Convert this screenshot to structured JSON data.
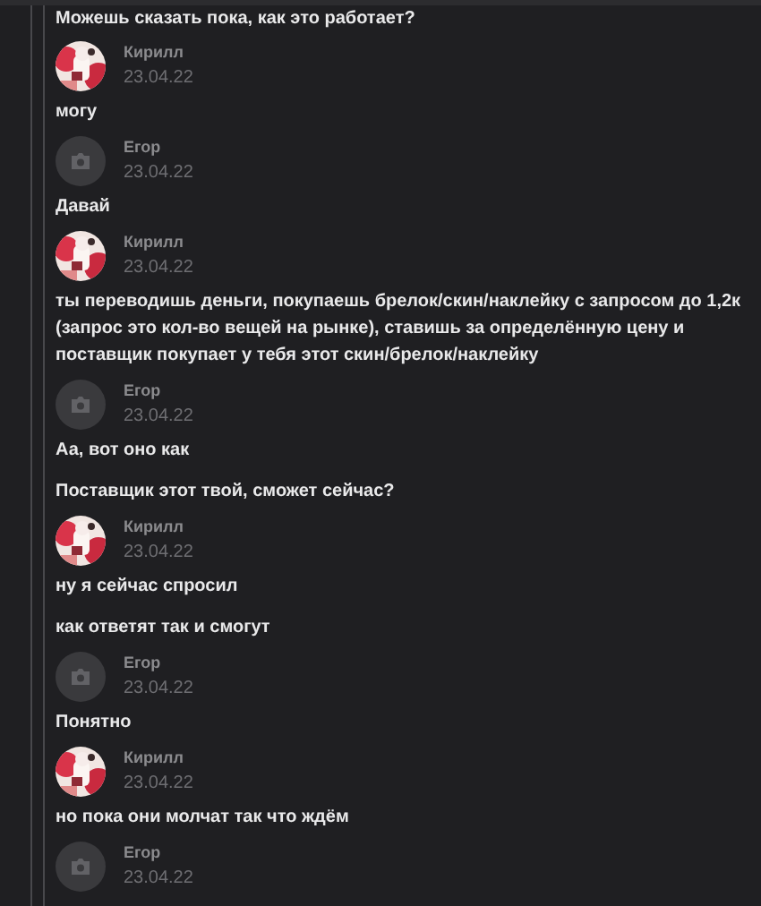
{
  "preceding_text": "Можешь сказать пока, как это работает?",
  "posts": [
    {
      "author": "Кирилл",
      "date": "23.04.22",
      "avatar": {
        "kind": "picture"
      },
      "texts": [
        "могу"
      ]
    },
    {
      "author": "Егор",
      "date": "23.04.22",
      "avatar": {
        "kind": "placeholder"
      },
      "texts": [
        "Давай"
      ]
    },
    {
      "author": "Кирилл",
      "date": "23.04.22",
      "avatar": {
        "kind": "picture"
      },
      "texts": [
        "ты переводишь деньги, покупаешь брелок/скин/наклейку с запросом до 1,2к (запрос это кол-во вещей на рынке), ставишь за определённую цену и поставщик покупает у тебя этот скин/брелок/наклейку"
      ]
    },
    {
      "author": "Егор",
      "date": "23.04.22",
      "avatar": {
        "kind": "placeholder"
      },
      "texts": [
        "Аа, вот оно как",
        "Поставщик этот твой, сможет сейчас?"
      ]
    },
    {
      "author": "Кирилл",
      "date": "23.04.22",
      "avatar": {
        "kind": "picture"
      },
      "texts": [
        "ну я сейчас спросил",
        "как ответят так и смогут"
      ]
    },
    {
      "author": "Егор",
      "date": "23.04.22",
      "avatar": {
        "kind": "placeholder"
      },
      "texts": [
        "Понятно"
      ]
    },
    {
      "author": "Кирилл",
      "date": "23.04.22",
      "avatar": {
        "kind": "picture"
      },
      "texts": [
        "но пока они молчат так что ждём"
      ]
    },
    {
      "author": "Егор",
      "date": "23.04.22",
      "avatar": {
        "kind": "placeholder"
      }
    }
  ]
}
